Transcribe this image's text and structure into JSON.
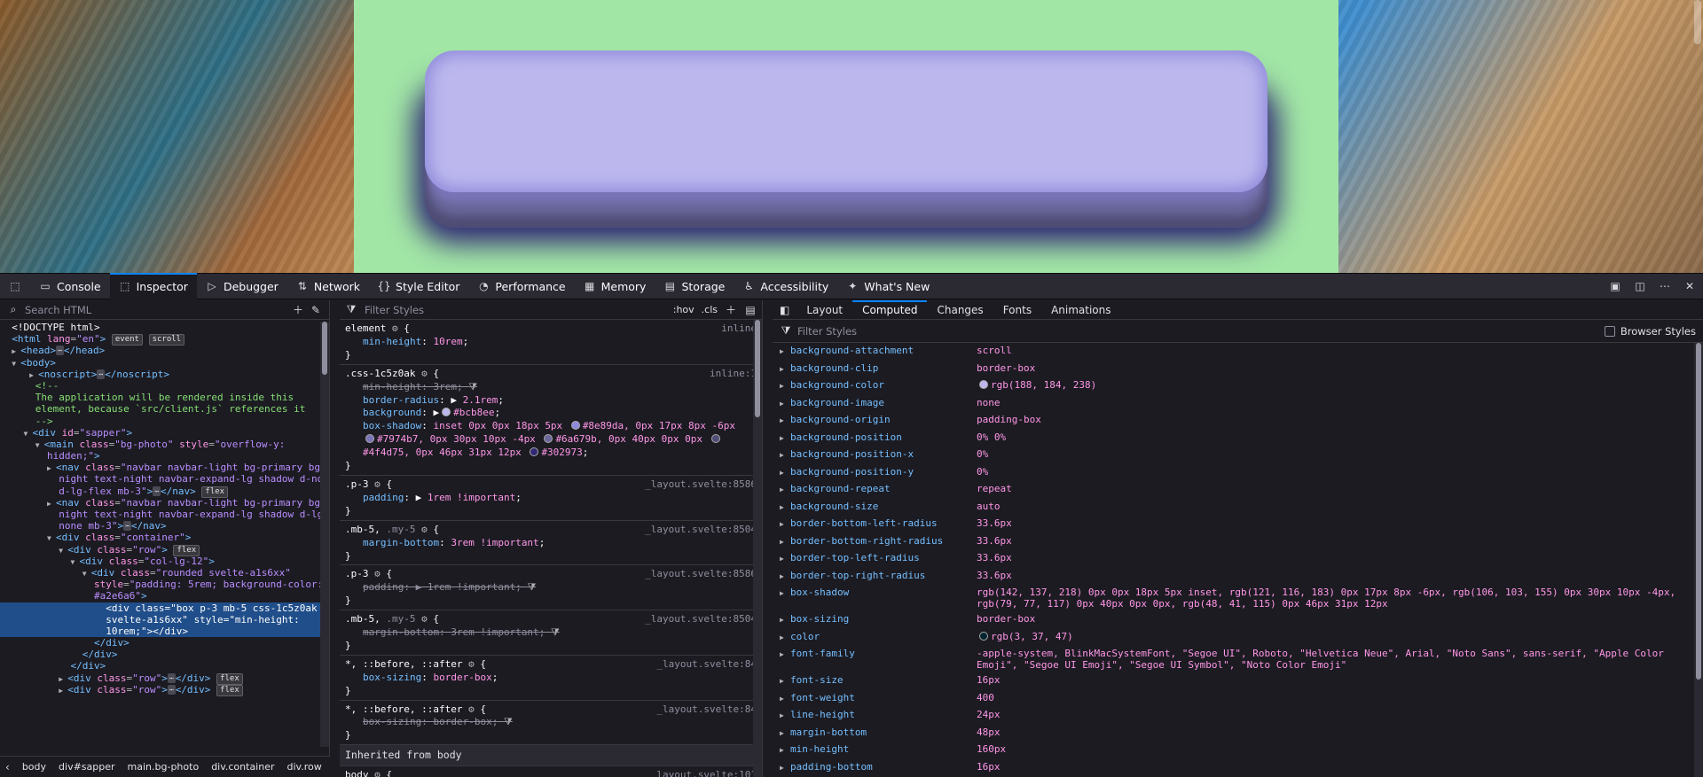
{
  "colors": {
    "green_container": "#a2e6a6",
    "box_background": "#bcb8ee",
    "accent": "#0a84ff"
  },
  "toolbar": {
    "tabs": [
      {
        "label": "Console",
        "icon": "console-icon"
      },
      {
        "label": "Inspector",
        "icon": "inspector-icon",
        "active": true
      },
      {
        "label": "Debugger",
        "icon": "debugger-icon"
      },
      {
        "label": "Network",
        "icon": "network-icon"
      },
      {
        "label": "Style Editor",
        "icon": "style-editor-icon"
      },
      {
        "label": "Performance",
        "icon": "performance-icon"
      },
      {
        "label": "Memory",
        "icon": "memory-icon"
      },
      {
        "label": "Storage",
        "icon": "storage-icon"
      },
      {
        "label": "Accessibility",
        "icon": "accessibility-icon"
      },
      {
        "label": "What's New",
        "icon": "whats-new-icon"
      }
    ]
  },
  "markup": {
    "search_placeholder": "Search HTML",
    "breadcrumbs": [
      "body",
      "div#sapper",
      "main.bg-photo",
      "div.container",
      "div.row"
    ]
  },
  "rules": {
    "filter_placeholder": "Filter Styles",
    "hov": ":hov",
    "cls": ".cls",
    "inherited_from": "Inherited from body"
  },
  "computed": {
    "tabs": [
      "Layout",
      "Computed",
      "Changes",
      "Fonts",
      "Animations"
    ],
    "active_tab": "Computed",
    "filter_placeholder": "Filter Styles",
    "browser_styles_label": "Browser Styles",
    "properties": [
      {
        "name": "background-attachment",
        "value": "scroll"
      },
      {
        "name": "background-clip",
        "value": "border-box"
      },
      {
        "name": "background-color",
        "value": "rgb(188, 184, 238)",
        "swatch": "#bcb8ee"
      },
      {
        "name": "background-image",
        "value": "none"
      },
      {
        "name": "background-origin",
        "value": "padding-box"
      },
      {
        "name": "background-position",
        "value": "0% 0%"
      },
      {
        "name": "background-position-x",
        "value": "0%"
      },
      {
        "name": "background-position-y",
        "value": "0%"
      },
      {
        "name": "background-repeat",
        "value": "repeat"
      },
      {
        "name": "background-size",
        "value": "auto"
      },
      {
        "name": "border-bottom-left-radius",
        "value": "33.6px"
      },
      {
        "name": "border-bottom-right-radius",
        "value": "33.6px"
      },
      {
        "name": "border-top-left-radius",
        "value": "33.6px"
      },
      {
        "name": "border-top-right-radius",
        "value": "33.6px"
      },
      {
        "name": "box-shadow",
        "value": "rgb(142, 137, 218) 0px 0px 18px 5px inset, rgb(121, 116, 183) 0px 17px 8px -6px, rgb(106, 103, 155) 0px 30px 10px -4px, rgb(79, 77, 117) 0px 40px 0px 0px, rgb(48, 41, 115) 0px 46px 31px 12px"
      },
      {
        "name": "box-sizing",
        "value": "border-box"
      },
      {
        "name": "color",
        "value": "rgb(3, 37, 47)",
        "swatch": "#03252f"
      },
      {
        "name": "font-family",
        "value": "-apple-system, BlinkMacSystemFont, \"Segoe UI\", Roboto, \"Helvetica Neue\", Arial, \"Noto Sans\", sans-serif, \"Apple Color Emoji\", \"Segoe UI Emoji\", \"Segoe UI Symbol\", \"Noto Color Emoji\""
      },
      {
        "name": "font-size",
        "value": "16px"
      },
      {
        "name": "font-weight",
        "value": "400"
      },
      {
        "name": "line-height",
        "value": "24px"
      },
      {
        "name": "margin-bottom",
        "value": "48px"
      },
      {
        "name": "min-height",
        "value": "160px"
      },
      {
        "name": "padding-bottom",
        "value": "16px"
      }
    ]
  }
}
